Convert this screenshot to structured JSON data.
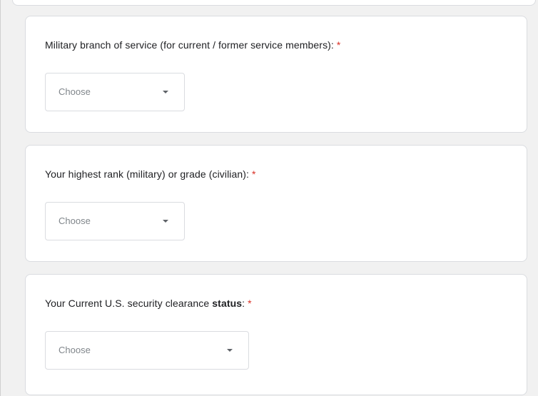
{
  "questions": [
    {
      "prefix": "Military branch of service (for current / former service members):",
      "bold": "",
      "suffix": "",
      "required_mark": "*",
      "select_placeholder": "Choose"
    },
    {
      "prefix": "Your highest rank (military) or grade (civilian):",
      "bold": "",
      "suffix": "",
      "required_mark": "*",
      "select_placeholder": "Choose"
    },
    {
      "prefix": "Your Current U.S. security clearance ",
      "bold": "status",
      "suffix": ":",
      "required_mark": "*",
      "select_placeholder": "Choose"
    }
  ],
  "colors": {
    "required": "#d93025",
    "card_border": "#dadce0",
    "text": "#202124",
    "placeholder": "#80868b"
  },
  "icons": {
    "dropdown": "dropdown-caret-icon"
  }
}
